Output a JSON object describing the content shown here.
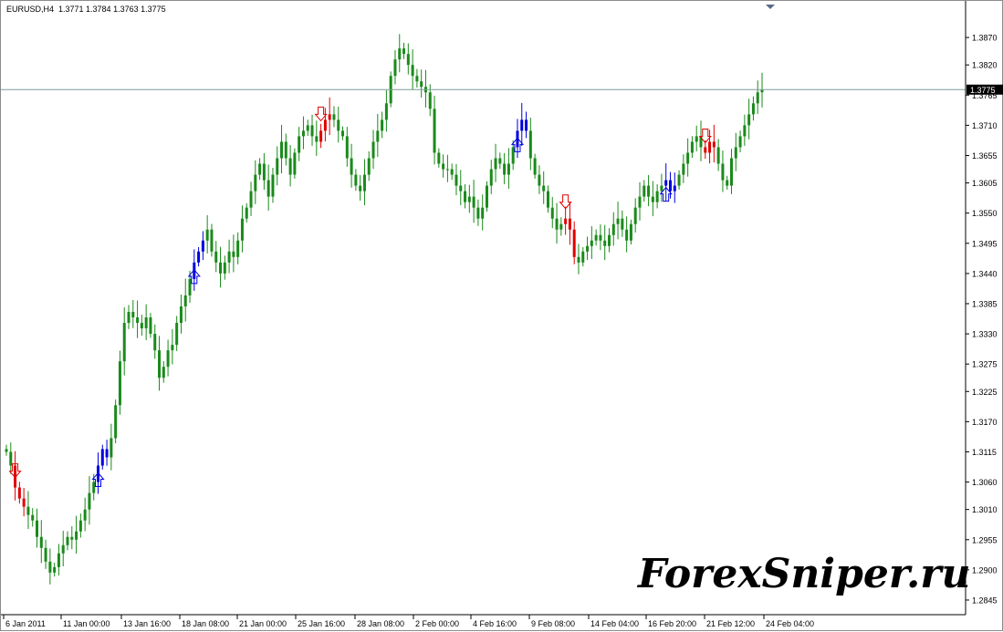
{
  "window": {
    "symbol_info": "EURUSD,H4  1.3771 1.3784 1.3763 1.3775",
    "watermark": "ForexSniper.ru"
  },
  "colors": {
    "candle_green": "#1a8a1a",
    "signal_red": "#e00000",
    "signal_blue": "#0000e0",
    "price_line": "#7f9c9c",
    "current_price_label_bg": "#000000",
    "current_price_label_text": "#ffffff"
  },
  "chart_data": {
    "type": "candlestick",
    "symbol": "EURUSD",
    "timeframe": "H4",
    "ylim": [
      1.282,
      1.392
    ],
    "y_ticks": [
      "1.3870",
      "1.3820",
      "1.3765",
      "1.3710",
      "1.3655",
      "1.3605",
      "1.3550",
      "1.3495",
      "1.3440",
      "1.3385",
      "1.3330",
      "1.3275",
      "1.3225",
      "1.3170",
      "1.3115",
      "1.3060",
      "1.3010",
      "1.2955",
      "1.2900",
      "1.2845"
    ],
    "x_ticks": [
      "6 Jan 2011",
      "11 Jan 00:00",
      "13 Jan 16:00",
      "18 Jan 08:00",
      "21 Jan 00:00",
      "25 Jan 16:00",
      "28 Jan 08:00",
      "2 Feb 00:00",
      "4 Feb 16:00",
      "9 Feb 08:00",
      "14 Feb 04:00",
      "16 Feb 20:00",
      "21 Feb 12:00",
      "24 Feb 04:00"
    ],
    "current_price": "1.3775",
    "closes": [
      1.3115,
      1.309,
      1.305,
      1.303,
      1.3015,
      1.3,
      1.299,
      1.296,
      1.294,
      1.2915,
      1.2895,
      1.2905,
      1.293,
      1.2945,
      1.296,
      1.2955,
      1.297,
      1.299,
      1.301,
      1.304,
      1.306,
      1.309,
      1.312,
      1.3105,
      1.314,
      1.32,
      1.328,
      1.335,
      1.337,
      1.336,
      1.335,
      1.334,
      1.336,
      1.333,
      1.33,
      1.325,
      1.327,
      1.33,
      1.331,
      1.335,
      1.338,
      1.34,
      1.343,
      1.346,
      1.348,
      1.35,
      1.352,
      1.348,
      1.346,
      1.344,
      1.346,
      1.348,
      1.347,
      1.35,
      1.354,
      1.356,
      1.359,
      1.362,
      1.364,
      1.361,
      1.358,
      1.362,
      1.365,
      1.368,
      1.365,
      1.362,
      1.366,
      1.369,
      1.37,
      1.371,
      1.369,
      1.368,
      1.37,
      1.372,
      1.373,
      1.372,
      1.37,
      1.369,
      1.365,
      1.362,
      1.36,
      1.359,
      1.362,
      1.365,
      1.368,
      1.37,
      1.372,
      1.375,
      1.38,
      1.383,
      1.385,
      1.384,
      1.382,
      1.38,
      1.379,
      1.378,
      1.377,
      1.374,
      1.366,
      1.364,
      1.363,
      1.363,
      1.362,
      1.36,
      1.359,
      1.357,
      1.358,
      1.356,
      1.354,
      1.356,
      1.36,
      1.363,
      1.365,
      1.364,
      1.362,
      1.364,
      1.367,
      1.37,
      1.372,
      1.37,
      1.365,
      1.362,
      1.36,
      1.359,
      1.356,
      1.354,
      1.352,
      1.353,
      1.354,
      1.352,
      1.347,
      1.346,
      1.348,
      1.349,
      1.35,
      1.351,
      1.35,
      1.349,
      1.351,
      1.353,
      1.354,
      1.352,
      1.35,
      1.353,
      1.356,
      1.358,
      1.36,
      1.358,
      1.357,
      1.359,
      1.36,
      1.361,
      1.359,
      1.36,
      1.362,
      1.364,
      1.366,
      1.368,
      1.369,
      1.367,
      1.366,
      1.368,
      1.367,
      1.364,
      1.361,
      1.36,
      1.365,
      1.367,
      1.369,
      1.371,
      1.373,
      1.375,
      1.377,
      1.3775
    ],
    "signals": [
      {
        "index": 2,
        "dir": "sell"
      },
      {
        "index": 21,
        "dir": "buy"
      },
      {
        "index": 43,
        "dir": "buy"
      },
      {
        "index": 72,
        "dir": "sell"
      },
      {
        "index": 117,
        "dir": "buy"
      },
      {
        "index": 128,
        "dir": "sell"
      },
      {
        "index": 151,
        "dir": "buy"
      },
      {
        "index": 160,
        "dir": "sell"
      }
    ]
  }
}
